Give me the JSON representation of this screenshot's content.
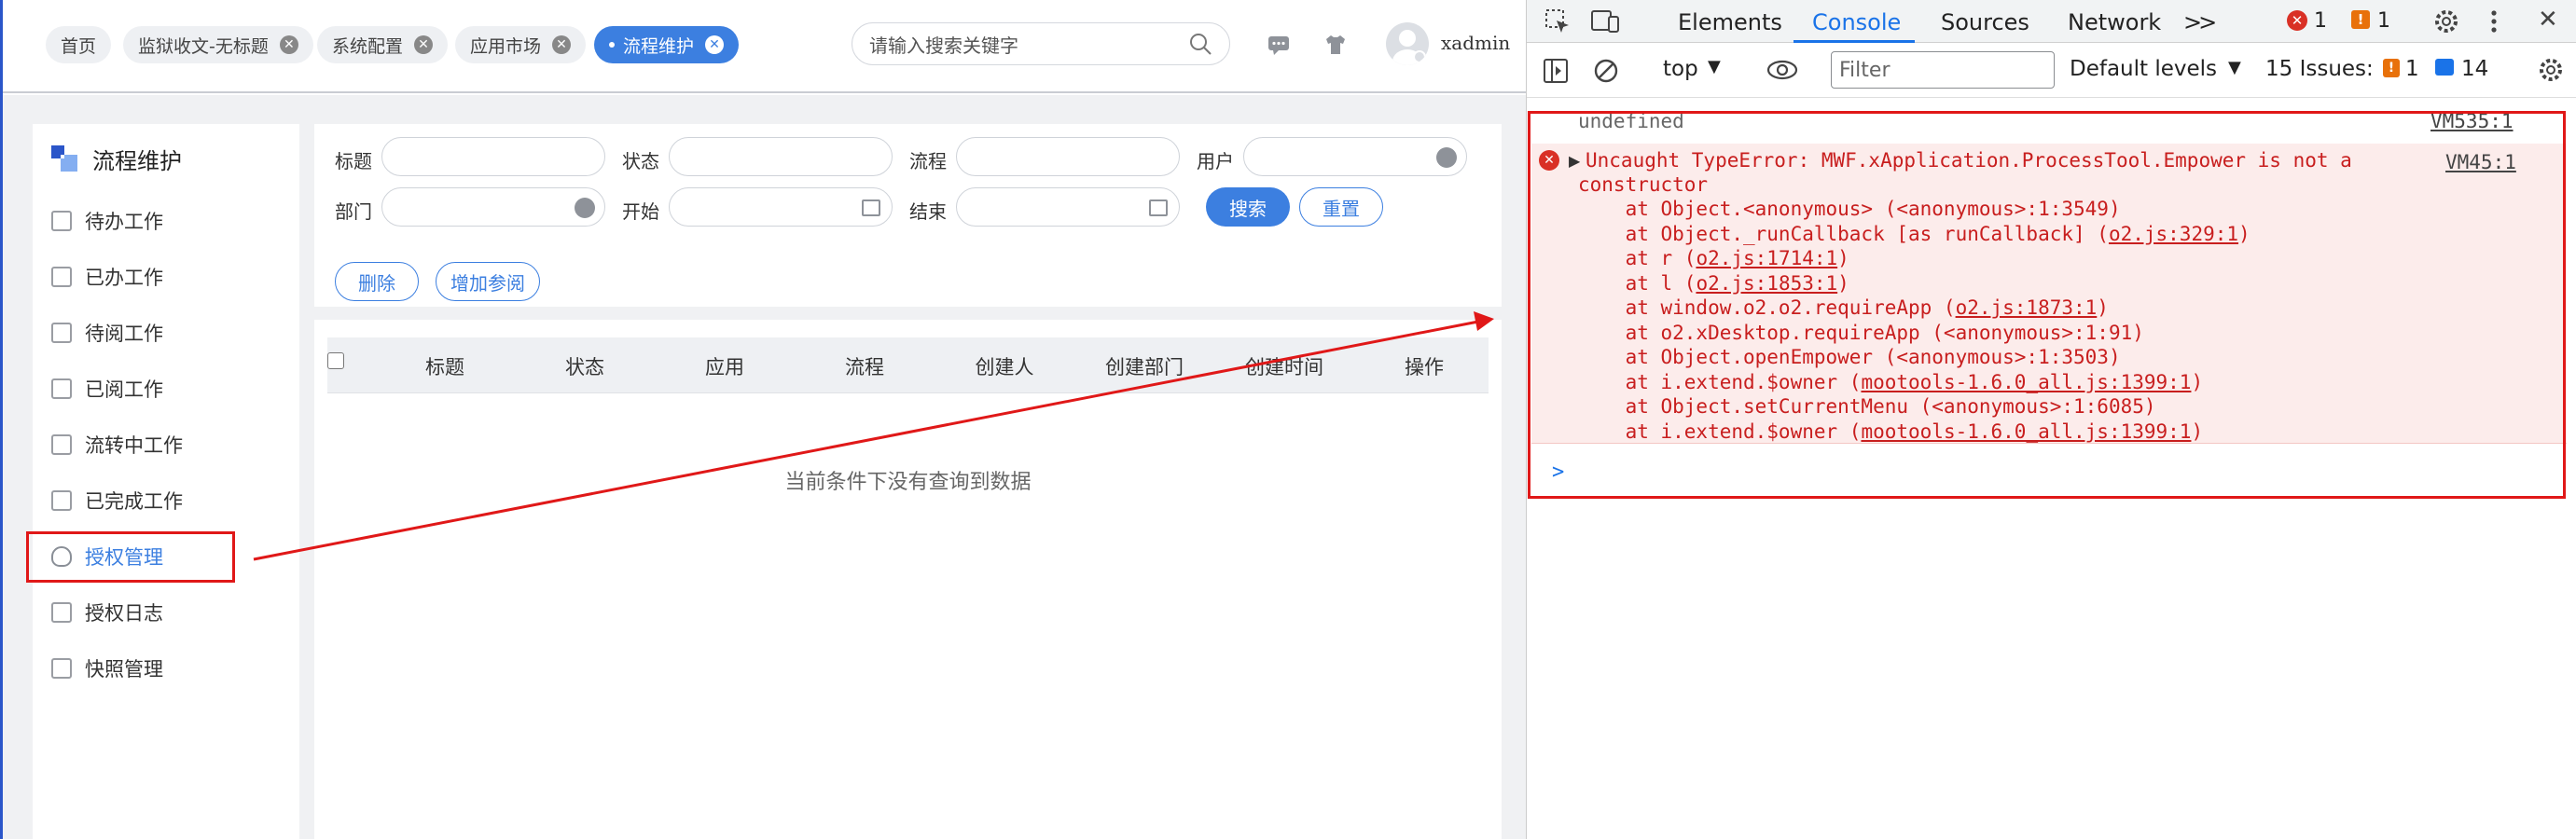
{
  "tabs": [
    {
      "label": "首页",
      "closable": false,
      "active": false
    },
    {
      "label": "监狱收文-无标题",
      "closable": true,
      "active": false
    },
    {
      "label": "系统配置",
      "closable": true,
      "active": false
    },
    {
      "label": "应用市场",
      "closable": true,
      "active": false
    },
    {
      "label": "流程维护",
      "closable": true,
      "active": true
    }
  ],
  "search": {
    "placeholder": "请输入搜索关键字"
  },
  "user": {
    "name": "xadmin"
  },
  "sidebar": {
    "title": "流程维护",
    "items": [
      {
        "label": "待办工作",
        "icon": "todo-icon"
      },
      {
        "label": "已办工作",
        "icon": "done-icon"
      },
      {
        "label": "待阅工作",
        "icon": "toread-icon"
      },
      {
        "label": "已阅工作",
        "icon": "read-icon"
      },
      {
        "label": "流转中工作",
        "icon": "flowing-icon"
      },
      {
        "label": "已完成工作",
        "icon": "completed-icon"
      },
      {
        "label": "授权管理",
        "icon": "shield-icon",
        "active": true
      },
      {
        "label": "授权日志",
        "icon": "edit-log-icon"
      },
      {
        "label": "快照管理",
        "icon": "camera-icon"
      }
    ]
  },
  "filter": {
    "labels": {
      "title": "标题",
      "status": "状态",
      "process": "流程",
      "user": "用户",
      "dept": "部门",
      "start": "开始",
      "end": "结束"
    },
    "search_btn": "搜索",
    "reset_btn": "重置",
    "delete_btn": "删除",
    "add_ref_btn": "增加参阅"
  },
  "table": {
    "headers": [
      "标题",
      "状态",
      "应用",
      "流程",
      "创建人",
      "创建部门",
      "创建时间",
      "操作"
    ],
    "empty_text": "当前条件下没有查询到数据"
  },
  "devtools": {
    "tabs": [
      "Elements",
      "Console",
      "Sources",
      "Network"
    ],
    "active_tab": "Console",
    "more": ">>",
    "error_count": "1",
    "warning_count": "1",
    "context": "top",
    "filter_placeholder": "Filter",
    "levels": "Default levels",
    "issues_label": "15 Issues:",
    "issues_warn": "1",
    "issues_info": "14",
    "accent": "#1a73e8"
  },
  "console": {
    "undefined_line": "undefined",
    "undefined_src": "VM535:1",
    "error_src": "VM45:1",
    "error_message": "Uncaught TypeError: MWF.xApplication.ProcessTool.Empower is not a",
    "error_message_2": "constructor",
    "stack": [
      {
        "pre": "    at Object.<anonymous> (<anonymous>:1:3549)",
        "link": "",
        "post": ""
      },
      {
        "pre": "    at Object._runCallback [as runCallback] (",
        "link": "o2.js:329:1",
        "post": ")"
      },
      {
        "pre": "    at r (",
        "link": "o2.js:1714:1",
        "post": ")"
      },
      {
        "pre": "    at l (",
        "link": "o2.js:1853:1",
        "post": ")"
      },
      {
        "pre": "    at window.o2.o2.requireApp (",
        "link": "o2.js:1873:1",
        "post": ")"
      },
      {
        "pre": "    at o2.xDesktop.requireApp (<anonymous>:1:91)",
        "link": "",
        "post": ""
      },
      {
        "pre": "    at Object.openEmpower (<anonymous>:1:3503)",
        "link": "",
        "post": ""
      },
      {
        "pre": "    at i.extend.$owner (",
        "link": "mootools-1.6.0_all.js:1399:1",
        "post": ")"
      },
      {
        "pre": "    at Object.setCurrentMenu (<anonymous>:1:6085)",
        "link": "",
        "post": ""
      },
      {
        "pre": "    at i.extend.$owner (",
        "link": "mootools-1.6.0_all.js:1399:1",
        "post": ")"
      }
    ],
    "prompt": ">"
  },
  "colors": {
    "brand": "#3c7fe0",
    "annotation": "#e01818",
    "error_text": "#c81e1e",
    "error_bg": "#fceceb"
  }
}
